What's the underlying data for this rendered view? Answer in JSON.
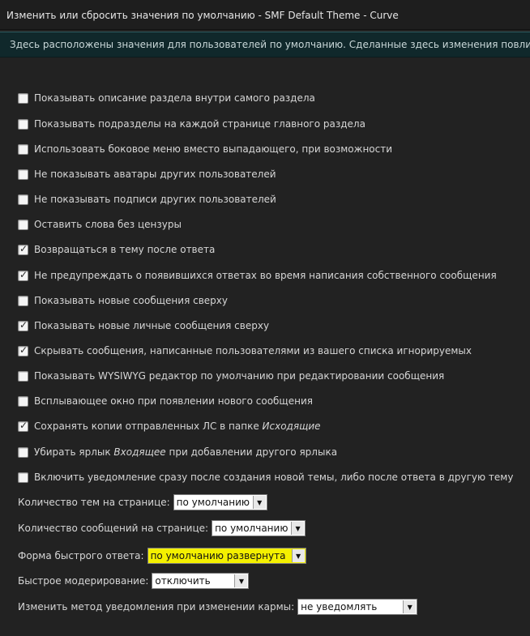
{
  "window": {
    "title": "Изменить или сбросить значения по умолчанию - SMF Default Theme - Curve"
  },
  "info_bar": {
    "text": "Здесь расположены значения для пользователей по умолчанию. Сделанные здесь изменения повлияют только"
  },
  "options": [
    {
      "label": "Показывать описание раздела внутри самого раздела",
      "checked": false
    },
    {
      "label": "Показывать подразделы на каждой странице главного раздела",
      "checked": false
    },
    {
      "label": "Использовать боковое меню вместо выпадающего, при возможности",
      "checked": false
    },
    {
      "label": "Не показывать аватары других пользователей",
      "checked": false
    },
    {
      "label": "Не показывать подписи других пользователей",
      "checked": false
    },
    {
      "label": "Оставить слова без цензуры",
      "checked": false
    },
    {
      "label": "Возвращаться в тему после ответа",
      "checked": true
    },
    {
      "label": "Не предупреждать о появившихся ответах во время написания собственного сообщения",
      "checked": true
    },
    {
      "label": "Показывать новые сообщения сверху",
      "checked": false
    },
    {
      "label": "Показывать новые личные сообщения сверху",
      "checked": true
    },
    {
      "label": "Скрывать сообщения, написанные пользователями из вашего списка игнорируемых",
      "checked": true
    },
    {
      "label": "Показывать WYSIWYG редактор по умолчанию при редактировании сообщения",
      "checked": false
    },
    {
      "label": "Всплывающее окно при появлении нового сообщения",
      "checked": false
    },
    {
      "label_before": "Сохранять копии отправленных ЛС в папке ",
      "label_italic": "Исходящие",
      "label_after": "",
      "checked": true
    },
    {
      "label_before": "Убирать ярлык ",
      "label_italic": "Входящее",
      "label_after": " при добавлении другого ярлыка",
      "checked": false
    },
    {
      "label": "Включить уведомление сразу после создания новой темы, либо после ответа в другую тему",
      "checked": false
    }
  ],
  "selects": [
    {
      "label": "Количество тем на странице:",
      "value": "по умолчанию",
      "highlight": false
    },
    {
      "label": "Количество сообщений на странице:",
      "value": "по умолчанию",
      "highlight": false
    },
    {
      "label": "Форма быстрого ответа:",
      "value": "по умолчанию развернута",
      "highlight": true
    },
    {
      "label": "Быстрое модерирование:",
      "value": "отключить",
      "highlight": false
    },
    {
      "label": "Изменить метод уведомления при изменении кармы:",
      "value": "не уведомлять",
      "highlight": false
    }
  ],
  "colors": {
    "background": "#222222",
    "info_bar": "#10282b",
    "highlight_select": "#f4f000"
  }
}
